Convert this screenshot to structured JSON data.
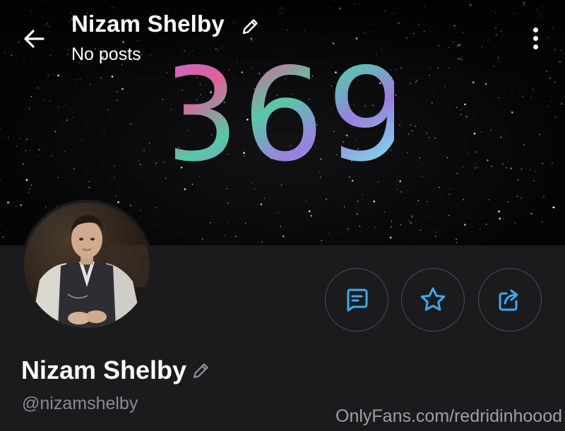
{
  "header": {
    "title": "Nizam Shelby",
    "subtitle": "No posts",
    "back_icon": "arrow-left-icon",
    "edit_icon": "pencil-icon",
    "menu_icon": "more-vertical-icon"
  },
  "banner": {
    "text": "369"
  },
  "profile": {
    "name": "Nizam Shelby",
    "handle": "@nizamshelby",
    "avatar_icon": "avatar"
  },
  "actions": [
    {
      "icon": "message-icon"
    },
    {
      "icon": "star-icon"
    },
    {
      "icon": "share-icon"
    }
  ],
  "watermark": "OnlyFans.com/redridinhoood",
  "colors": {
    "background": "#1b1b1e",
    "accent": "#3fa9f5",
    "muted_text": "#8a8a8f"
  }
}
